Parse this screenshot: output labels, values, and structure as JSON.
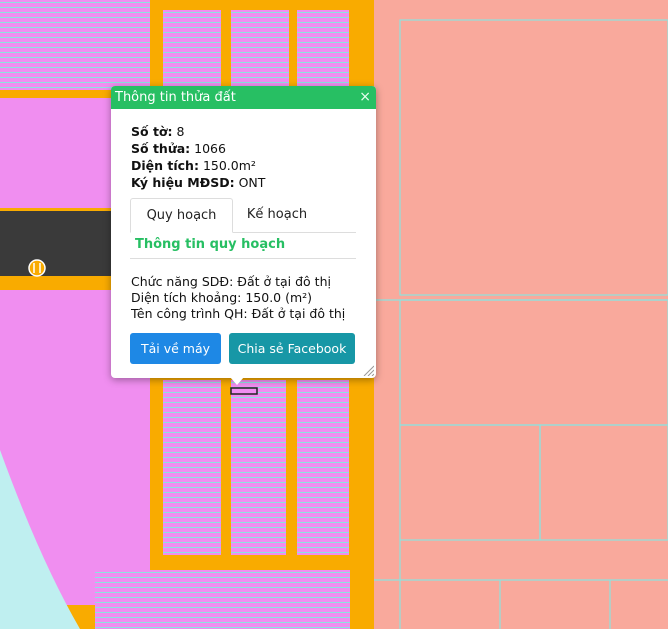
{
  "colors": {
    "road": "#f9ab00",
    "residential": "#f08ef0",
    "farmland": "#f9a99c",
    "parcel_line": "#8de3e0",
    "popup_header": "#27bf63",
    "download_button": "#1e88e5",
    "share_button": "#1797a6"
  },
  "popup": {
    "title": "Thông tin thửa đất",
    "close_icon": "×",
    "fields": [
      {
        "label": "Số tờ:",
        "value": "8"
      },
      {
        "label": "Số thửa:",
        "value": "1066"
      },
      {
        "label": "Diện tích:",
        "value": "150.0m²"
      },
      {
        "label": "Ký hiệu MĐSD:",
        "value": "ONT"
      }
    ],
    "tabs": [
      {
        "label": "Quy hoạch",
        "active": true
      },
      {
        "label": "Kế hoạch",
        "active": false
      }
    ],
    "section_title": "Thông tin quy hoạch",
    "details": [
      "Chức năng SDĐ: Đất ở tại đô thị",
      "Diện tích khoảng: 150.0 (m²)",
      "Tên công trình QH: Đất ở tại đô thị"
    ],
    "buttons": {
      "download": "Tải về máy",
      "share": "Chia sẻ Facebook"
    }
  },
  "map_icons": {
    "restaurant_icon": "restaurant-icon"
  }
}
